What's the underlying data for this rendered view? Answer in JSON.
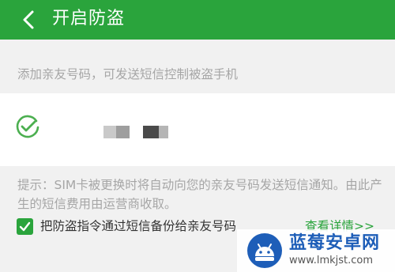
{
  "header": {
    "title": "开启防盗",
    "back_icon": "chevron-left-icon",
    "bg_color": "#2aa43c"
  },
  "hint_top": "添加亲友号码，可发送短信控制被盗手机",
  "contact": {
    "status_icon": "check-circle-icon",
    "number_masked": true
  },
  "tip": "提示：SIM卡被更换时将自动向您的亲友号码发送短信通知。由此产生的短信费用由运营商收取。",
  "backup_option": {
    "checked": true,
    "label": "把防盗指令通过短信备份给亲友号码",
    "link": "查看详情>>"
  },
  "watermark": {
    "name": "蓝莓安卓网",
    "url": "www.lmkjst.com"
  },
  "colors": {
    "accent": "#2aa43c",
    "hint_text": "#a6a6a6",
    "watermark_blue": "#1e5eb8"
  }
}
